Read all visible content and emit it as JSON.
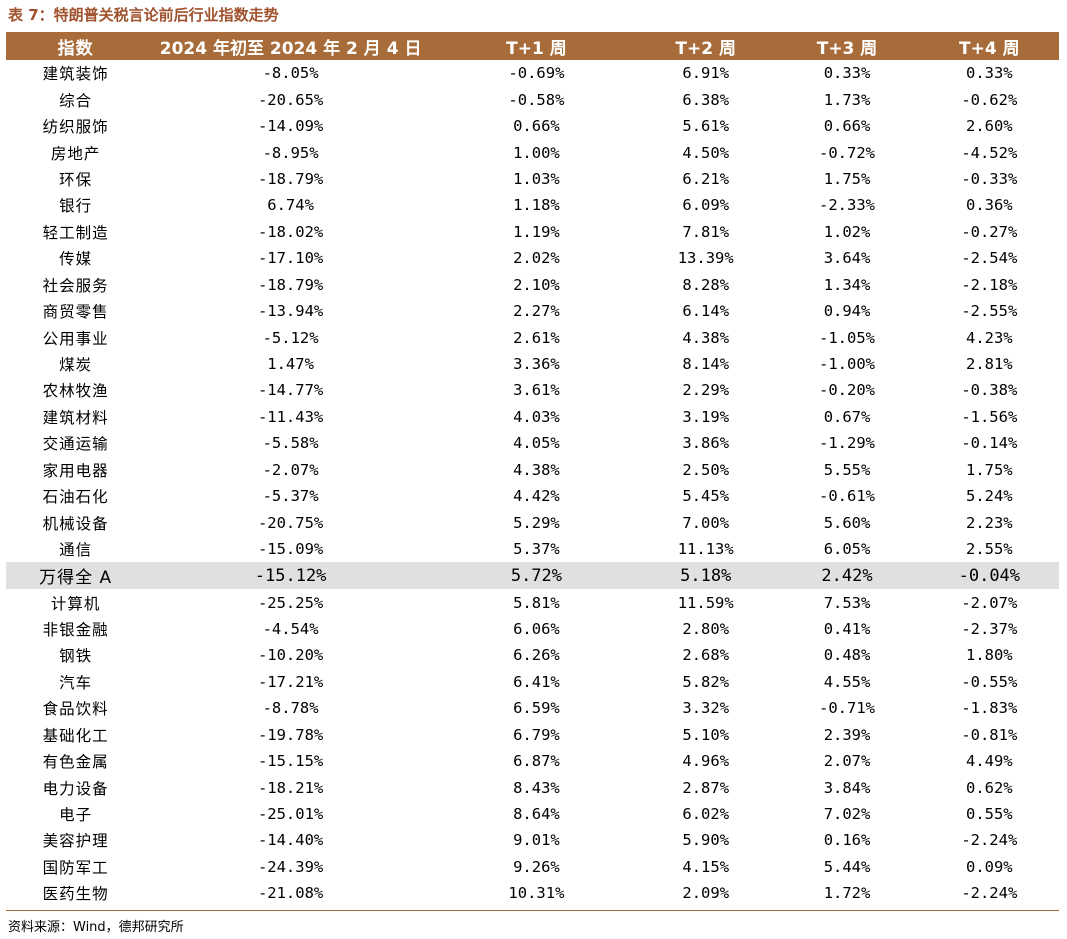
{
  "caption": "表 7：特朗普关税言论前后行业指数走势",
  "headers": [
    "指数",
    "2024 年初至 2024 年 2 月 4 日",
    "T+1 周",
    "T+2 周",
    "T+3 周",
    "T+4 周"
  ],
  "rows": [
    [
      "建筑装饰",
      "-8.05%",
      "-0.69%",
      "6.91%",
      "0.33%",
      "0.33%"
    ],
    [
      "综合",
      "-20.65%",
      "-0.58%",
      "6.38%",
      "1.73%",
      "-0.62%"
    ],
    [
      "纺织服饰",
      "-14.09%",
      "0.66%",
      "5.61%",
      "0.66%",
      "2.60%"
    ],
    [
      "房地产",
      "-8.95%",
      "1.00%",
      "4.50%",
      "-0.72%",
      "-4.52%"
    ],
    [
      "环保",
      "-18.79%",
      "1.03%",
      "6.21%",
      "1.75%",
      "-0.33%"
    ],
    [
      "银行",
      "6.74%",
      "1.18%",
      "6.09%",
      "-2.33%",
      "0.36%"
    ],
    [
      "轻工制造",
      "-18.02%",
      "1.19%",
      "7.81%",
      "1.02%",
      "-0.27%"
    ],
    [
      "传媒",
      "-17.10%",
      "2.02%",
      "13.39%",
      "3.64%",
      "-2.54%"
    ],
    [
      "社会服务",
      "-18.79%",
      "2.10%",
      "8.28%",
      "1.34%",
      "-2.18%"
    ],
    [
      "商贸零售",
      "-13.94%",
      "2.27%",
      "6.14%",
      "0.94%",
      "-2.55%"
    ],
    [
      "公用事业",
      "-5.12%",
      "2.61%",
      "4.38%",
      "-1.05%",
      "4.23%"
    ],
    [
      "煤炭",
      "1.47%",
      "3.36%",
      "8.14%",
      "-1.00%",
      "2.81%"
    ],
    [
      "农林牧渔",
      "-14.77%",
      "3.61%",
      "2.29%",
      "-0.20%",
      "-0.38%"
    ],
    [
      "建筑材料",
      "-11.43%",
      "4.03%",
      "3.19%",
      "0.67%",
      "-1.56%"
    ],
    [
      "交通运输",
      "-5.58%",
      "4.05%",
      "3.86%",
      "-1.29%",
      "-0.14%"
    ],
    [
      "家用电器",
      "-2.07%",
      "4.38%",
      "2.50%",
      "5.55%",
      "1.75%"
    ],
    [
      "石油石化",
      "-5.37%",
      "4.42%",
      "5.45%",
      "-0.61%",
      "5.24%"
    ],
    [
      "机械设备",
      "-20.75%",
      "5.29%",
      "7.00%",
      "5.60%",
      "2.23%"
    ],
    [
      "通信",
      "-15.09%",
      "5.37%",
      "11.13%",
      "6.05%",
      "2.55%"
    ],
    [
      "万得全 A",
      "-15.12%",
      "5.72%",
      "5.18%",
      "2.42%",
      "-0.04%"
    ],
    [
      "计算机",
      "-25.25%",
      "5.81%",
      "11.59%",
      "7.53%",
      "-2.07%"
    ],
    [
      "非银金融",
      "-4.54%",
      "6.06%",
      "2.80%",
      "0.41%",
      "-2.37%"
    ],
    [
      "钢铁",
      "-10.20%",
      "6.26%",
      "2.68%",
      "0.48%",
      "1.80%"
    ],
    [
      "汽车",
      "-17.21%",
      "6.41%",
      "5.82%",
      "4.55%",
      "-0.55%"
    ],
    [
      "食品饮料",
      "-8.78%",
      "6.59%",
      "3.32%",
      "-0.71%",
      "-1.83%"
    ],
    [
      "基础化工",
      "-19.78%",
      "6.79%",
      "5.10%",
      "2.39%",
      "-0.81%"
    ],
    [
      "有色金属",
      "-15.15%",
      "6.87%",
      "4.96%",
      "2.07%",
      "4.49%"
    ],
    [
      "电力设备",
      "-18.21%",
      "8.43%",
      "2.87%",
      "3.84%",
      "0.62%"
    ],
    [
      "电子",
      "-25.01%",
      "8.64%",
      "6.02%",
      "7.02%",
      "0.55%"
    ],
    [
      "美容护理",
      "-14.40%",
      "9.01%",
      "5.90%",
      "0.16%",
      "-2.24%"
    ],
    [
      "国防军工",
      "-24.39%",
      "9.26%",
      "4.15%",
      "5.44%",
      "0.09%"
    ],
    [
      "医药生物",
      "-21.08%",
      "10.31%",
      "2.09%",
      "1.72%",
      "-2.24%"
    ]
  ],
  "highlight_row_label": "万得全 A",
  "source": "资料来源：Wind，德邦研究所",
  "colors": {
    "header_bg": "#a86c3a",
    "caption": "#a0522d",
    "highlight_bg": "#e0e0e0"
  }
}
